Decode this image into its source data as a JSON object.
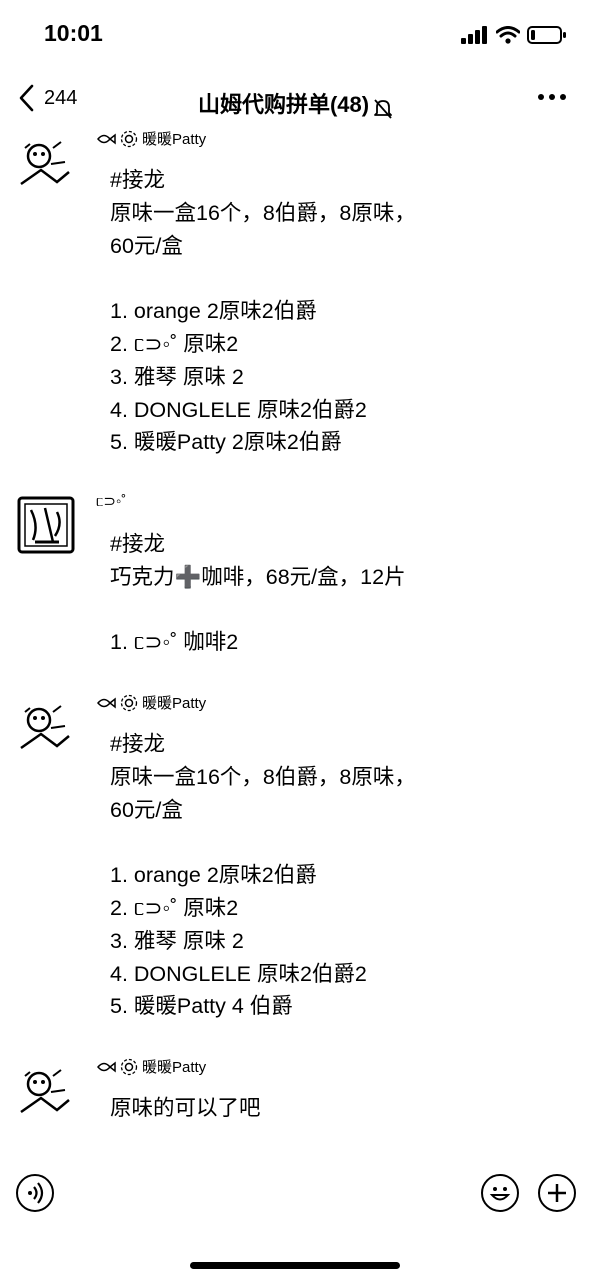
{
  "status_bar": {
    "time": "10:01"
  },
  "nav": {
    "back_count": "244",
    "title": "山姆代购拼单(48)",
    "icons": [
      "back-chevron-icon",
      "muted-bell-icon",
      "more-icon"
    ]
  },
  "messages": [
    {
      "sender": "暖暖Patty",
      "text": "#接龙\n原味一盒16个，8伯爵，8原味，\n60元/盒\n\n1. orange 2原味2伯爵\n2. ᥴ⊃◦˚ 原味2\n3. 雅琴 原味 2\n4. DONGLELE 原味2伯爵2\n5. 暖暖Patty 2原味2伯爵"
    },
    {
      "sender": "ᥴ⊃◦˚",
      "text": "#接龙\n巧克力➕咖啡，68元/盒，12片\n\n1. ᥴ⊃◦˚ 咖啡2"
    },
    {
      "sender": "暖暖Patty",
      "text": "#接龙\n原味一盒16个，8伯爵，8原味，\n60元/盒\n\n1. orange 2原味2伯爵\n2. ᥴ⊃◦˚ 原味2\n3. 雅琴 原味 2\n4. DONGLELE 原味2伯爵2\n5. 暖暖Patty 4 伯爵"
    },
    {
      "sender": "暖暖Patty",
      "text": "原味的可以了吧"
    }
  ],
  "bottom_bar": {
    "icons": [
      "voice-icon",
      "emoji-icon",
      "plus-icon"
    ]
  }
}
